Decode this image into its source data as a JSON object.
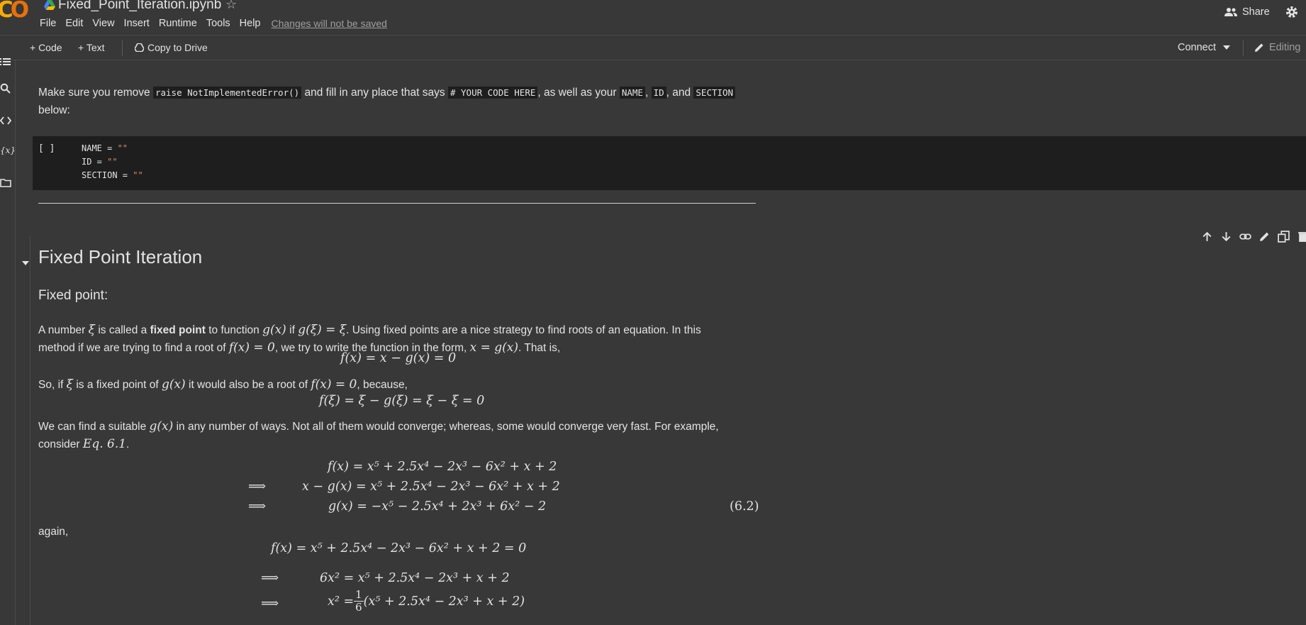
{
  "header": {
    "notebook_title": "Fixed_Point_Iteration.ipynb",
    "menu": [
      "File",
      "Edit",
      "View",
      "Insert",
      "Runtime",
      "Tools",
      "Help"
    ],
    "unsaved_notice": "Changes will not be saved",
    "share_label": "Share"
  },
  "toolbar": {
    "code_label": "+ Code",
    "text_label": "+ Text",
    "copy_label": "Copy to Drive",
    "connect_label": "Connect",
    "editing_label": "Editing"
  },
  "rail_icons": [
    "toc-icon",
    "search-icon",
    "code-snippets-icon",
    "variables-icon",
    "files-icon"
  ],
  "intro": {
    "t1": "Make sure you remove ",
    "c1": "raise NotImplementedError()",
    "t2": " and fill in any place that says ",
    "c2": "# YOUR CODE HERE",
    "t3": ", as well as your ",
    "c3": "NAME",
    "t4": ", ",
    "c4": "ID",
    "t5": ", and ",
    "c5": "SECTION",
    "t6": "below:"
  },
  "code_cell": {
    "bracket": "[ ]",
    "lines": [
      {
        "var": "NAME = ",
        "val": "\"\""
      },
      {
        "var": "ID = ",
        "val": "\"\""
      },
      {
        "var": "SECTION = ",
        "val": "\"\""
      }
    ]
  },
  "section": {
    "heading": "Fixed Point Iteration",
    "subheading": "Fixed point:",
    "p1a": "A number ",
    "xi": "ξ",
    "p1b": " is called a ",
    "p1bold": "fixed point",
    "p1c": " to function ",
    "gx": "g(x)",
    "p1d": " if ",
    "gxi": "g(ξ) = ξ",
    "p1e": ". Using fixed points are a nice strategy to find roots of an equation. In this",
    "p2a": "method if we are trying to find a root of ",
    "fx0": "f(x) = 0",
    "p2b": ", we try to write the function in the form, ",
    "xgx": "x = g(x)",
    "p2c": ". That is,",
    "eq1": "f(x) = x − g(x) = 0",
    "p3a": "So, if ",
    "p3b": " is a fixed point of ",
    "p3c": " it would also be a root of ",
    "p3d": ", because,",
    "eq2": "f(ξ) = ξ − g(ξ) = ξ − ξ = 0",
    "p4a": "We can find a suitable ",
    "p4b": " in any number of ways. Not all of them would converge; whereas, some would converge very fast. For example,",
    "p5a": "consider ",
    "eqref": "Eq. 6.1",
    "p5b": ".",
    "implies": "⟹",
    "align1": "f(x) = x⁵ + 2.5x⁴ − 2x³ − 6x² + x + 2",
    "align2": "x − g(x) = x⁵ + 2.5x⁴ − 2x³ − 6x² + x + 2",
    "align3": "g(x) = −x⁵ − 2.5x⁴ + 2x³ + 6x² − 2",
    "tag": "(6.2)",
    "again": "again,",
    "eq3": "f(x) = x⁵ + 2.5x⁴ − 2x³ − 6x² + x + 2 = 0",
    "eq4": "6x² = x⁵ + 2.5x⁴ − 2x³ + x + 2",
    "eq5_lhs": "x² = ",
    "frac_num": "1",
    "frac_den": "6",
    "eq5_rhs": "(x⁵ + 2.5x⁴ − 2x³ + x + 2)"
  },
  "colors": {
    "background": "#383838",
    "code_bg": "#1e1e1e",
    "logo_yellow": "#f9ab00",
    "logo_orange": "#e8710a"
  }
}
